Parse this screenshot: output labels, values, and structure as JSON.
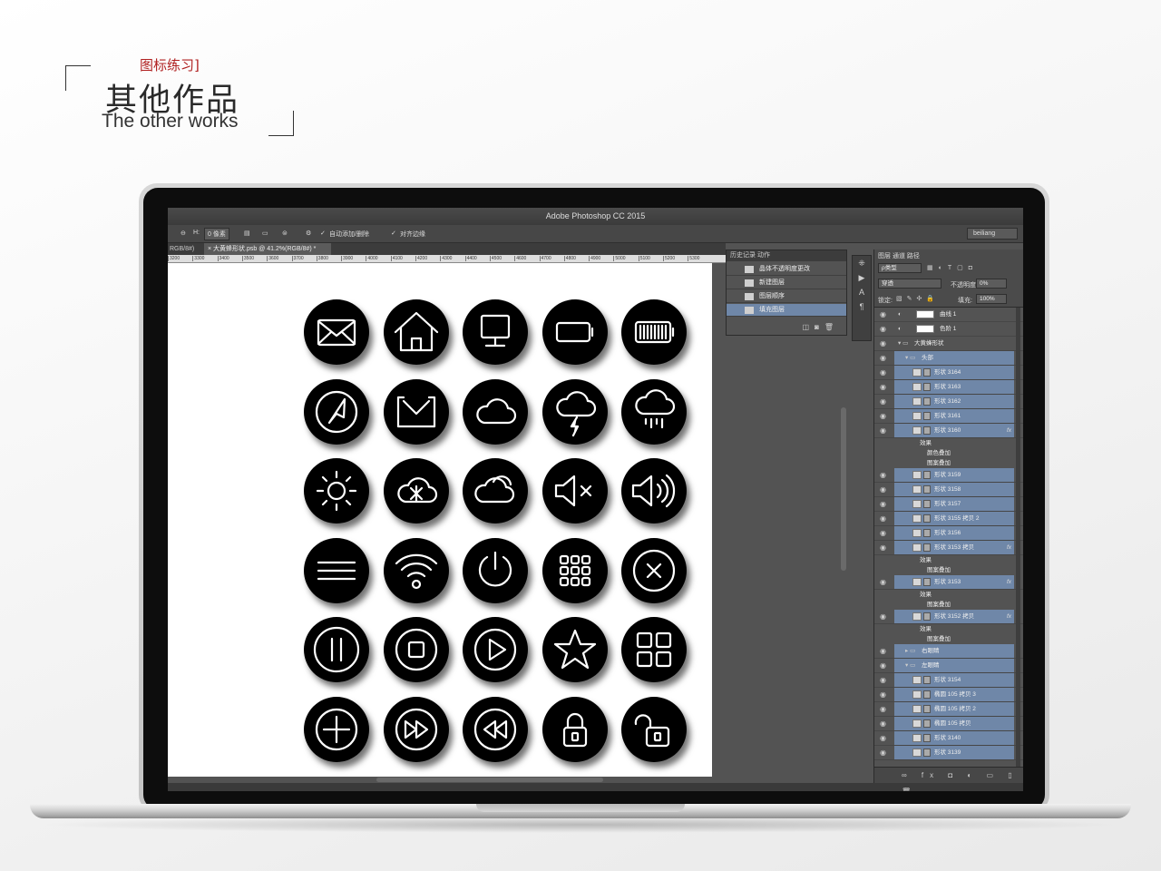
{
  "header": {
    "subtitle_cn": "图标练习]",
    "title_cn": "其他作品",
    "title_en": "The other works"
  },
  "photoshop": {
    "app_title": "Adobe Photoshop CC 2015",
    "options": {
      "h_label": "H:",
      "h_value": "0 像素",
      "auto_add_delete": "自动添加/删除",
      "align_edges": "对齐边缘",
      "workspace": "beiliang"
    },
    "doc_tab": {
      "left_fragment": "RGB/8#)",
      "active": "大黄蜂形状.psb @ 41.2%(RGB/8#) *"
    },
    "ruler_ticks": [
      "3200",
      "3300",
      "3400",
      "3500",
      "3600",
      "3700",
      "3800",
      "3900",
      "4000",
      "4100",
      "4200",
      "4300",
      "4400",
      "4500",
      "4600",
      "4700",
      "4800",
      "4900",
      "5000",
      "5100",
      "5200",
      "5300"
    ],
    "history_panel": {
      "tabs": "历史记录   动作",
      "items": [
        "晶体不透明度更改",
        "新建图层",
        "图层顺序",
        "填充图层"
      ],
      "selected_index": 3
    },
    "layers_panel": {
      "tabs": "图层   通道   路径",
      "kind": "ρ类型",
      "blend_mode": "穿透",
      "opacity_label": "不透明度:",
      "opacity_value": "0%",
      "lock_label": "锁定:",
      "fill_label": "填充:",
      "fill_value": "100%",
      "rows": [
        {
          "name": "曲线 1",
          "type": "adj",
          "indent": 0,
          "selected": false
        },
        {
          "name": "色阶 1",
          "type": "adj",
          "indent": 0,
          "selected": false
        },
        {
          "name": "大黄蜂形状",
          "type": "group",
          "indent": 0,
          "selected": false
        },
        {
          "name": "头部",
          "type": "group",
          "indent": 1,
          "selected": true
        },
        {
          "name": "形状 3164",
          "type": "shape",
          "indent": 2,
          "selected": true
        },
        {
          "name": "形状 3163",
          "type": "shape",
          "indent": 2,
          "selected": true
        },
        {
          "name": "形状 3162",
          "type": "shape",
          "indent": 2,
          "selected": true
        },
        {
          "name": "形状 3161",
          "type": "shape",
          "indent": 2,
          "selected": true
        },
        {
          "name": "形状 3160",
          "type": "shape",
          "indent": 2,
          "selected": true,
          "fx": "fx"
        },
        {
          "name": "效果",
          "type": "fx",
          "indent": 3
        },
        {
          "name": "颜色叠加",
          "type": "fx",
          "indent": 4
        },
        {
          "name": "图案叠加",
          "type": "fx",
          "indent": 4
        },
        {
          "name": "形状 3159",
          "type": "shape",
          "indent": 2,
          "selected": true
        },
        {
          "name": "形状 3158",
          "type": "shape",
          "indent": 2,
          "selected": true
        },
        {
          "name": "形状 3157",
          "type": "shape",
          "indent": 2,
          "selected": true
        },
        {
          "name": "形状 3155 拷贝 2",
          "type": "shape",
          "indent": 2,
          "selected": true
        },
        {
          "name": "形状 3156",
          "type": "shape",
          "indent": 2,
          "selected": true
        },
        {
          "name": "形状 3153 拷贝",
          "type": "shape",
          "indent": 2,
          "selected": true,
          "fx": "fx"
        },
        {
          "name": "效果",
          "type": "fx",
          "indent": 3
        },
        {
          "name": "图案叠加",
          "type": "fx",
          "indent": 4
        },
        {
          "name": "形状 3153",
          "type": "shape",
          "indent": 2,
          "selected": true,
          "fx": "fx"
        },
        {
          "name": "效果",
          "type": "fx",
          "indent": 3
        },
        {
          "name": "图案叠加",
          "type": "fx",
          "indent": 4
        },
        {
          "name": "形状 3152 拷贝",
          "type": "shape",
          "indent": 2,
          "selected": true,
          "fx": "fx"
        },
        {
          "name": "效果",
          "type": "fx",
          "indent": 3
        },
        {
          "name": "图案叠加",
          "type": "fx",
          "indent": 4
        },
        {
          "name": "右眼睛",
          "type": "group",
          "indent": 1,
          "selected": true
        },
        {
          "name": "左眼睛",
          "type": "group",
          "indent": 1,
          "selected": true
        },
        {
          "name": "形状 3154",
          "type": "shape",
          "indent": 2,
          "selected": true
        },
        {
          "name": "椭圆 105 拷贝 3",
          "type": "shape",
          "indent": 2,
          "selected": true
        },
        {
          "name": "椭圆 105 拷贝 2",
          "type": "shape",
          "indent": 2,
          "selected": true
        },
        {
          "name": "椭圆 105 拷贝",
          "type": "shape",
          "indent": 2,
          "selected": true
        },
        {
          "name": "形状 3140",
          "type": "shape",
          "indent": 2,
          "selected": true
        },
        {
          "name": "形状 3139",
          "type": "shape",
          "indent": 2,
          "selected": true
        }
      ],
      "footer_icons": "∞ fx ◘ ◐ ▭ ▯ 🗑"
    },
    "canvas_icons": [
      [
        "mail-icon",
        "home-icon",
        "monitor-icon",
        "battery-empty-icon",
        "battery-full-icon"
      ],
      [
        "navigation-icon",
        "inbox-icon",
        "cloud-icon",
        "thunderstorm-icon",
        "rain-icon"
      ],
      [
        "sun-icon",
        "cloud-snow-icon",
        "clouds-icon",
        "volume-mute-icon",
        "volume-up-icon"
      ],
      [
        "menu-icon",
        "wifi-icon",
        "power-icon",
        "apps-icon",
        "close-icon"
      ],
      [
        "pause-icon",
        "stop-icon",
        "play-icon",
        "star-icon",
        "grid-icon"
      ],
      [
        "add-icon",
        "fast-forward-icon",
        "rewind-icon",
        "lock-icon",
        "unlock-icon"
      ]
    ]
  }
}
